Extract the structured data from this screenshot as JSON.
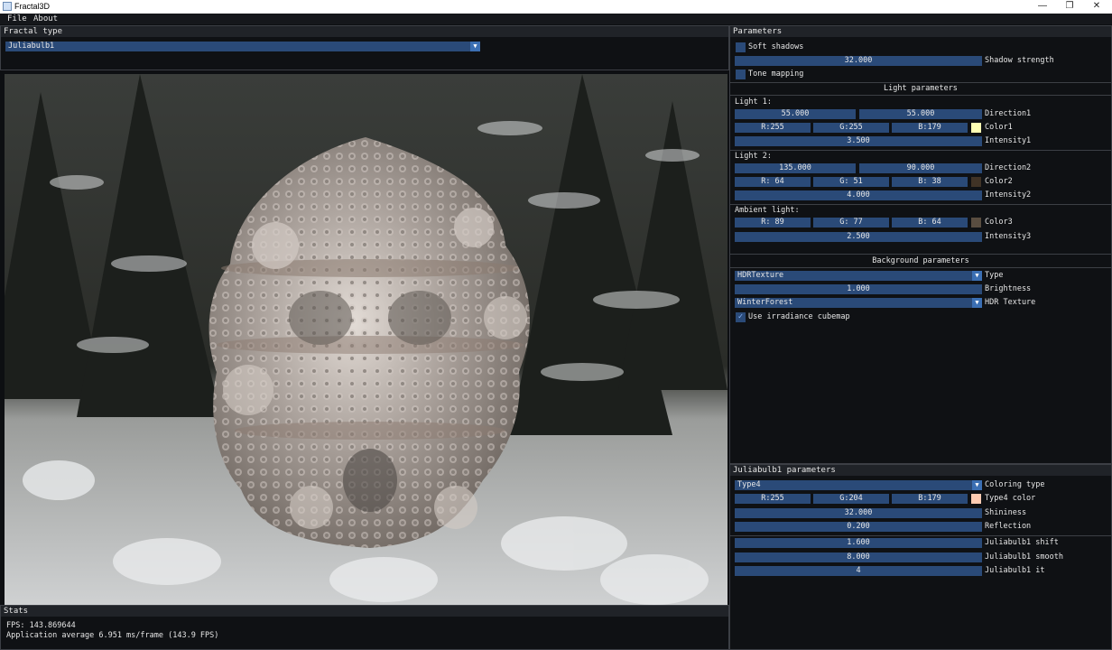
{
  "window": {
    "title": "Fractal3D",
    "min_icon": "minimize-icon",
    "max_icon": "restore-icon",
    "close_icon": "close-icon"
  },
  "menu": {
    "file": "File",
    "about": "About"
  },
  "fractal_type": {
    "title": "Fractal type",
    "selected": "Juliabulb1"
  },
  "parameters": {
    "title": "Parameters",
    "soft_shadows": "Soft shadows",
    "shadow_strength_value": "32.000",
    "shadow_strength_label": "Shadow strength",
    "tone_mapping": "Tone mapping",
    "light_header": "Light parameters",
    "light1_label": "Light 1:",
    "light1_dir_a": "55.000",
    "light1_dir_b": "55.000",
    "direction1": "Direction1",
    "light1_r": "R:255",
    "light1_g": "G:255",
    "light1_b": "B:179",
    "color1": "Color1",
    "color1_swatch": "#ffffb3",
    "intensity1_value": "3.500",
    "intensity1": "Intensity1",
    "light2_label": "Light 2:",
    "light2_dir_a": "135.000",
    "light2_dir_b": "90.000",
    "direction2": "Direction2",
    "light2_r": "R: 64",
    "light2_g": "G: 51",
    "light2_b": "B: 38",
    "color2": "Color2",
    "color2_swatch": "#403326",
    "intensity2_value": "4.000",
    "intensity2": "Intensity2",
    "ambient_label": "Ambient light:",
    "ambient_r": "R: 89",
    "ambient_g": "G: 77",
    "ambient_b": "B: 64",
    "color3": "Color3",
    "color3_swatch": "#594d40",
    "intensity3_value": "2.500",
    "intensity3": "Intensity3",
    "background_header": "Background parameters",
    "bg_type_value": "HDRTexture",
    "bg_type_label": "Type",
    "brightness_value": "1.000",
    "brightness_label": "Brightness",
    "hdr_texture_value": "WinterForest",
    "hdr_texture_label": "HDR Texture",
    "irradiance": "Use irradiance cubemap"
  },
  "juliabulb": {
    "title": "Juliabulb1 parameters",
    "coloring_value": "Type4",
    "coloring_label": "Coloring type",
    "type4_r": "R:255",
    "type4_g": "G:204",
    "type4_b": "B:179",
    "type4_color": "Type4 color",
    "type4_swatch": "#ffccb3",
    "shininess_value": "32.000",
    "shininess_label": "Shininess",
    "reflection_value": "0.200",
    "reflection_label": "Reflection",
    "shift_value": "1.600",
    "shift_label": "Juliabulb1 shift",
    "smooth_value": "8.000",
    "smooth_label": "Juliabulb1 smooth",
    "it_value": "4",
    "it_label": "Juliabulb1 it"
  },
  "stats": {
    "title": "Stats",
    "fps": "FPS: 143.869644",
    "average": "Application average 6.951 ms/frame (143.9 FPS)"
  }
}
